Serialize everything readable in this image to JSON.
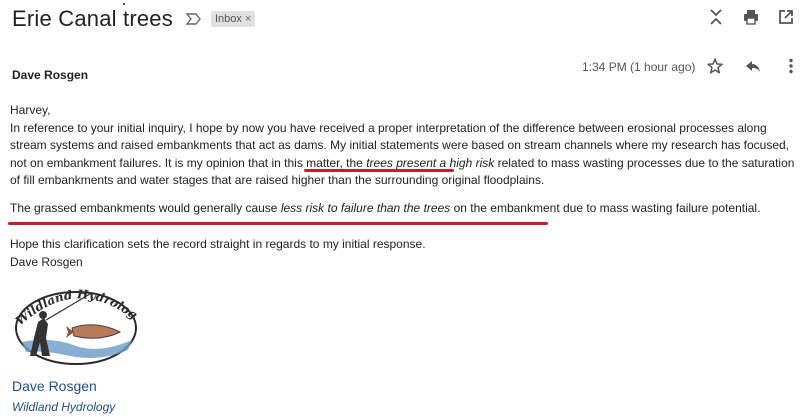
{
  "email": {
    "subject": "Erie Canal trees",
    "label": "Inbox",
    "label_close": "×",
    "sender": "Dave Rosgen",
    "time": "1:34 PM (1 hour ago)"
  },
  "body": {
    "greeting": "Harvey,",
    "para1_a": "In reference to your initial inquiry, I hope by now you have received a proper interpretation of the difference between erosional processes along stream systems and raised embankments that act as dams.  My initial statements were based on stream channels where my research has focused, not on embankment failures.  It is my opinion that in this matter, the ",
    "para1_em": "trees present a high risk",
    "para1_b": " related to mass wasting processes due to the saturation of fill embankments and water stages that are raised higher than the surrounding original floodplains.",
    "para2_a": "The grassed embankments would generally cause ",
    "para2_em": "less risk to failure than the trees",
    "para2_b": " on the embankment due to mass wasting failure potential.",
    "closing": "Hope this clarification sets the record straight in regards to my initial response.",
    "signoff": "Dave Rosgen"
  },
  "signature": {
    "logo_text": "Wildland Hydrology",
    "name": "Dave Rosgen",
    "org": "Wildland Hydrology"
  },
  "icons": {
    "important": "label-important-icon",
    "expand": "expand-icon",
    "print": "print-icon",
    "open_new": "open-in-new-window-icon",
    "star": "star-icon",
    "reply": "reply-icon",
    "more": "more-vert-icon"
  },
  "colors": {
    "underline": "#c0202a",
    "signature": "#1f4e8c"
  }
}
